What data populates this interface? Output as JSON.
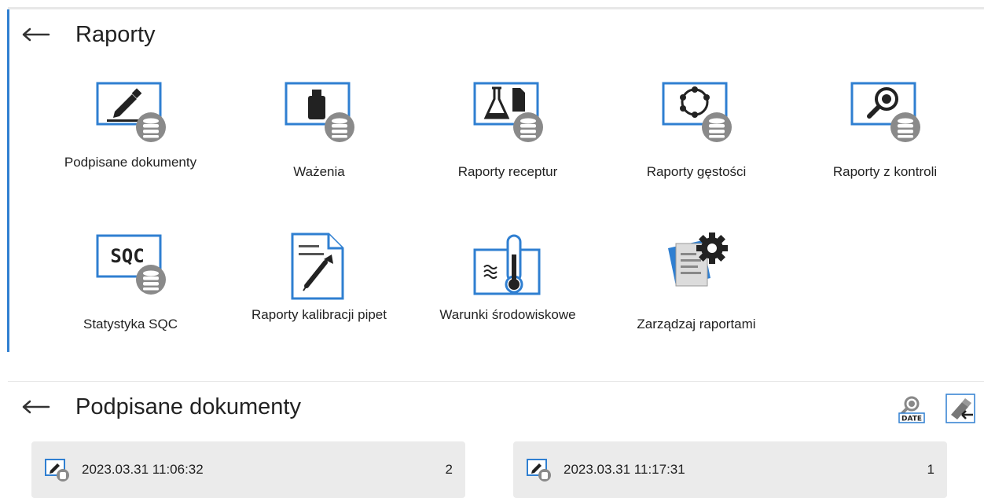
{
  "reports_panel": {
    "title": "Raporty",
    "tiles": [
      {
        "label": "Podpisane dokumenty",
        "icon": "signature-database-icon"
      },
      {
        "label": "Ważenia",
        "icon": "weight-database-icon"
      },
      {
        "label": "Raporty receptur",
        "icon": "flask-database-icon"
      },
      {
        "label": "Raporty gęstości",
        "icon": "density-database-icon"
      },
      {
        "label": "Raporty z kontroli",
        "icon": "magnifier-database-icon"
      },
      {
        "label": "Statystyka SQC",
        "icon": "sqc-database-icon"
      },
      {
        "label": "Raporty kalibracji pipet",
        "icon": "pipette-report-icon"
      },
      {
        "label": "Warunki środowiskowe",
        "icon": "thermometer-icon"
      },
      {
        "label": "Zarządzaj raportami",
        "icon": "report-gear-icon"
      }
    ]
  },
  "signed_docs_panel": {
    "title": "Podpisane dokumenty",
    "filter_icon_text": "DATE",
    "records": [
      {
        "date": "2023.03.31 11:06:32",
        "count": "2"
      },
      {
        "date": "2023.03.31 11:17:31",
        "count": "1"
      }
    ]
  },
  "colors": {
    "accent": "#2f7fd1",
    "badge": "#8a8a8a",
    "record_bg": "#ebebeb"
  }
}
